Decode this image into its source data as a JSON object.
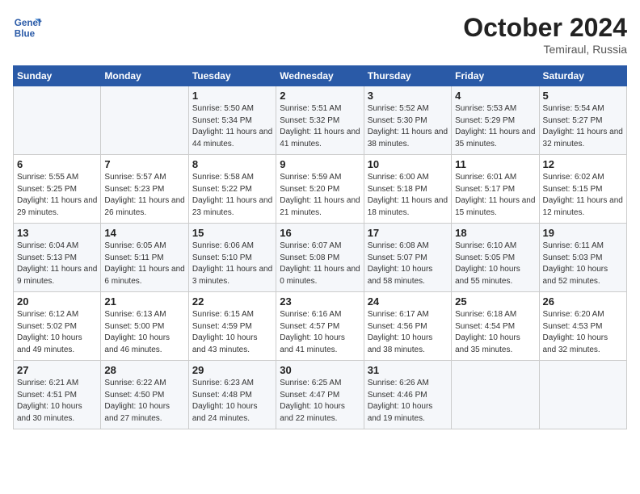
{
  "header": {
    "logo_line1": "General",
    "logo_line2": "Blue",
    "month": "October 2024",
    "location": "Temiraul, Russia"
  },
  "weekdays": [
    "Sunday",
    "Monday",
    "Tuesday",
    "Wednesday",
    "Thursday",
    "Friday",
    "Saturday"
  ],
  "weeks": [
    [
      {
        "day": "",
        "info": ""
      },
      {
        "day": "",
        "info": ""
      },
      {
        "day": "1",
        "info": "Sunrise: 5:50 AM\nSunset: 5:34 PM\nDaylight: 11 hours and 44 minutes."
      },
      {
        "day": "2",
        "info": "Sunrise: 5:51 AM\nSunset: 5:32 PM\nDaylight: 11 hours and 41 minutes."
      },
      {
        "day": "3",
        "info": "Sunrise: 5:52 AM\nSunset: 5:30 PM\nDaylight: 11 hours and 38 minutes."
      },
      {
        "day": "4",
        "info": "Sunrise: 5:53 AM\nSunset: 5:29 PM\nDaylight: 11 hours and 35 minutes."
      },
      {
        "day": "5",
        "info": "Sunrise: 5:54 AM\nSunset: 5:27 PM\nDaylight: 11 hours and 32 minutes."
      }
    ],
    [
      {
        "day": "6",
        "info": "Sunrise: 5:55 AM\nSunset: 5:25 PM\nDaylight: 11 hours and 29 minutes."
      },
      {
        "day": "7",
        "info": "Sunrise: 5:57 AM\nSunset: 5:23 PM\nDaylight: 11 hours and 26 minutes."
      },
      {
        "day": "8",
        "info": "Sunrise: 5:58 AM\nSunset: 5:22 PM\nDaylight: 11 hours and 23 minutes."
      },
      {
        "day": "9",
        "info": "Sunrise: 5:59 AM\nSunset: 5:20 PM\nDaylight: 11 hours and 21 minutes."
      },
      {
        "day": "10",
        "info": "Sunrise: 6:00 AM\nSunset: 5:18 PM\nDaylight: 11 hours and 18 minutes."
      },
      {
        "day": "11",
        "info": "Sunrise: 6:01 AM\nSunset: 5:17 PM\nDaylight: 11 hours and 15 minutes."
      },
      {
        "day": "12",
        "info": "Sunrise: 6:02 AM\nSunset: 5:15 PM\nDaylight: 11 hours and 12 minutes."
      }
    ],
    [
      {
        "day": "13",
        "info": "Sunrise: 6:04 AM\nSunset: 5:13 PM\nDaylight: 11 hours and 9 minutes."
      },
      {
        "day": "14",
        "info": "Sunrise: 6:05 AM\nSunset: 5:11 PM\nDaylight: 11 hours and 6 minutes."
      },
      {
        "day": "15",
        "info": "Sunrise: 6:06 AM\nSunset: 5:10 PM\nDaylight: 11 hours and 3 minutes."
      },
      {
        "day": "16",
        "info": "Sunrise: 6:07 AM\nSunset: 5:08 PM\nDaylight: 11 hours and 0 minutes."
      },
      {
        "day": "17",
        "info": "Sunrise: 6:08 AM\nSunset: 5:07 PM\nDaylight: 10 hours and 58 minutes."
      },
      {
        "day": "18",
        "info": "Sunrise: 6:10 AM\nSunset: 5:05 PM\nDaylight: 10 hours and 55 minutes."
      },
      {
        "day": "19",
        "info": "Sunrise: 6:11 AM\nSunset: 5:03 PM\nDaylight: 10 hours and 52 minutes."
      }
    ],
    [
      {
        "day": "20",
        "info": "Sunrise: 6:12 AM\nSunset: 5:02 PM\nDaylight: 10 hours and 49 minutes."
      },
      {
        "day": "21",
        "info": "Sunrise: 6:13 AM\nSunset: 5:00 PM\nDaylight: 10 hours and 46 minutes."
      },
      {
        "day": "22",
        "info": "Sunrise: 6:15 AM\nSunset: 4:59 PM\nDaylight: 10 hours and 43 minutes."
      },
      {
        "day": "23",
        "info": "Sunrise: 6:16 AM\nSunset: 4:57 PM\nDaylight: 10 hours and 41 minutes."
      },
      {
        "day": "24",
        "info": "Sunrise: 6:17 AM\nSunset: 4:56 PM\nDaylight: 10 hours and 38 minutes."
      },
      {
        "day": "25",
        "info": "Sunrise: 6:18 AM\nSunset: 4:54 PM\nDaylight: 10 hours and 35 minutes."
      },
      {
        "day": "26",
        "info": "Sunrise: 6:20 AM\nSunset: 4:53 PM\nDaylight: 10 hours and 32 minutes."
      }
    ],
    [
      {
        "day": "27",
        "info": "Sunrise: 6:21 AM\nSunset: 4:51 PM\nDaylight: 10 hours and 30 minutes."
      },
      {
        "day": "28",
        "info": "Sunrise: 6:22 AM\nSunset: 4:50 PM\nDaylight: 10 hours and 27 minutes."
      },
      {
        "day": "29",
        "info": "Sunrise: 6:23 AM\nSunset: 4:48 PM\nDaylight: 10 hours and 24 minutes."
      },
      {
        "day": "30",
        "info": "Sunrise: 6:25 AM\nSunset: 4:47 PM\nDaylight: 10 hours and 22 minutes."
      },
      {
        "day": "31",
        "info": "Sunrise: 6:26 AM\nSunset: 4:46 PM\nDaylight: 10 hours and 19 minutes."
      },
      {
        "day": "",
        "info": ""
      },
      {
        "day": "",
        "info": ""
      }
    ]
  ]
}
